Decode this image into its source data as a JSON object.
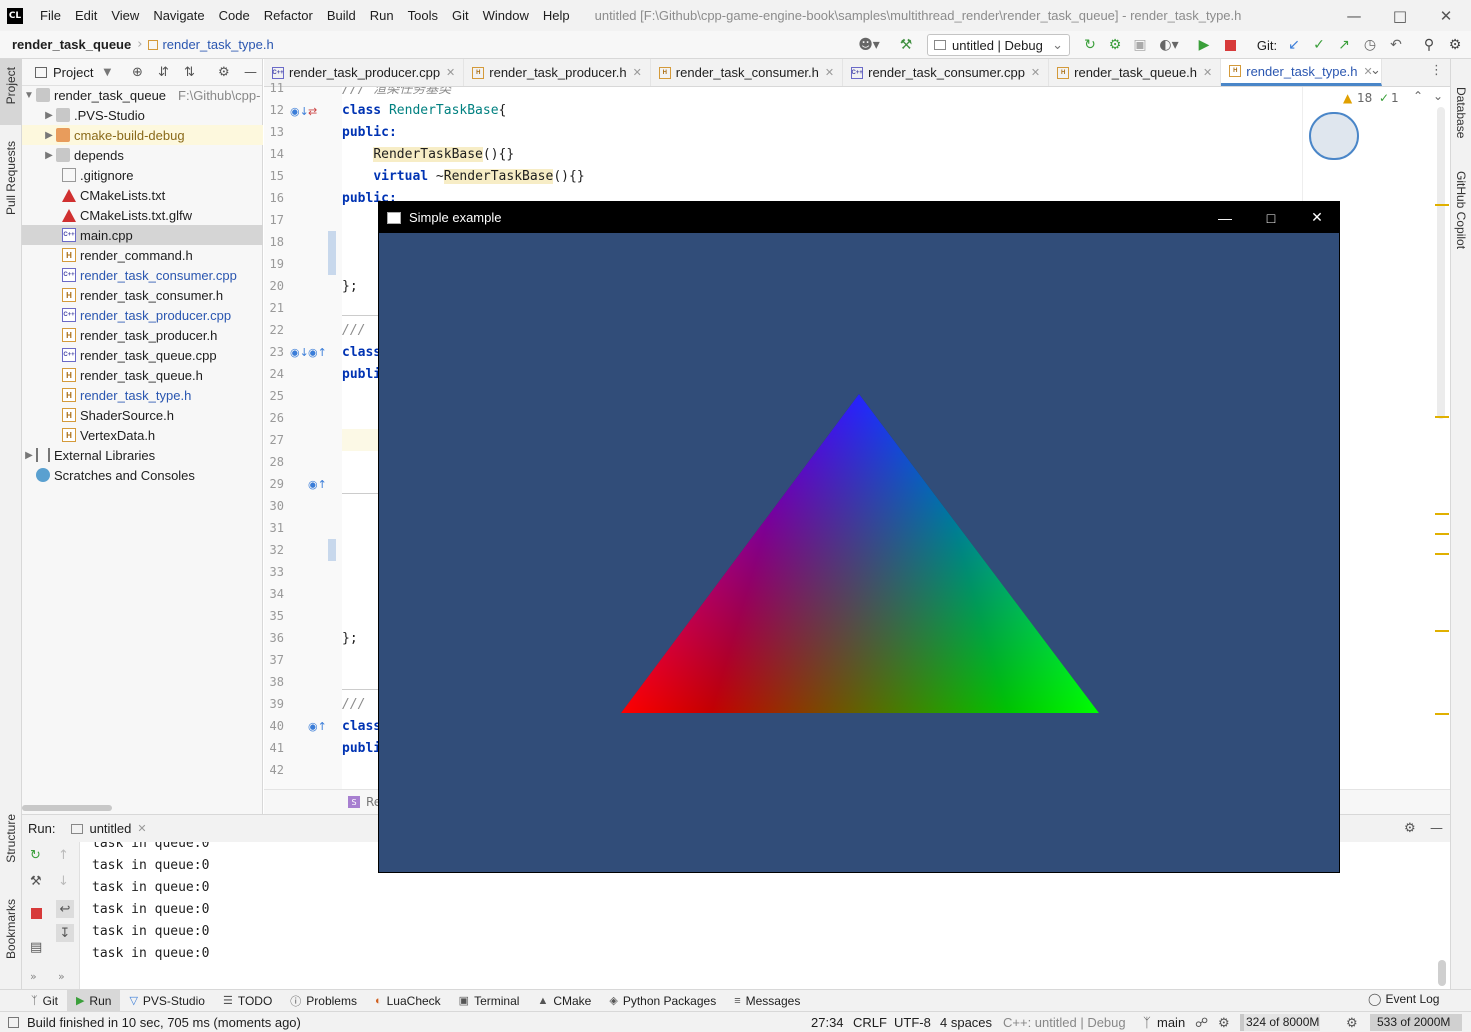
{
  "app": {
    "logo": "CL",
    "menu": [
      "File",
      "Edit",
      "View",
      "Navigate",
      "Code",
      "Refactor",
      "Build",
      "Run",
      "Tools",
      "Git",
      "Window",
      "Help"
    ],
    "title": "untitled [F:\\Github\\cpp-game-engine-book\\samples\\multithread_render\\render_task_queue] - render_task_type.h"
  },
  "navbar": {
    "project": "render_task_queue",
    "file": "render_task_type.h",
    "run_config": "untitled | Debug",
    "git_label": "Git:"
  },
  "left_strip": {
    "project": "Project",
    "pull_requests": "Pull Requests",
    "structure": "Structure",
    "bookmarks": "Bookmarks"
  },
  "right_strip": {
    "database": "Database",
    "copilot": "GitHub Copilot"
  },
  "project_panel": {
    "title": "Project",
    "root": {
      "name": "render_task_queue",
      "path": "F:\\Github\\cpp-"
    },
    "items": [
      {
        "label": ".PVS-Studio",
        "kind": "folder"
      },
      {
        "label": "cmake-build-debug",
        "kind": "folder-orange"
      },
      {
        "label": "depends",
        "kind": "folder"
      },
      {
        "label": ".gitignore",
        "kind": "file"
      },
      {
        "label": "CMakeLists.txt",
        "kind": "cmake"
      },
      {
        "label": "CMakeLists.txt.glfw",
        "kind": "cmake"
      },
      {
        "label": "main.cpp",
        "kind": "cpp"
      },
      {
        "label": "render_command.h",
        "kind": "h"
      },
      {
        "label": "render_task_consumer.cpp",
        "kind": "cpp"
      },
      {
        "label": "render_task_consumer.h",
        "kind": "h"
      },
      {
        "label": "render_task_producer.cpp",
        "kind": "cpp"
      },
      {
        "label": "render_task_producer.h",
        "kind": "h"
      },
      {
        "label": "render_task_queue.cpp",
        "kind": "cpp"
      },
      {
        "label": "render_task_queue.h",
        "kind": "h"
      },
      {
        "label": "render_task_type.h",
        "kind": "h"
      },
      {
        "label": "ShaderSource.h",
        "kind": "h"
      },
      {
        "label": "VertexData.h",
        "kind": "h"
      }
    ],
    "external": "External Libraries",
    "scratches": "Scratches and Consoles"
  },
  "tabs": [
    {
      "label": "render_task_producer.cpp",
      "kind": "cpp"
    },
    {
      "label": "render_task_producer.h",
      "kind": "h"
    },
    {
      "label": "render_task_consumer.h",
      "kind": "h"
    },
    {
      "label": "render_task_consumer.cpp",
      "kind": "cpp"
    },
    {
      "label": "render_task_queue.h",
      "kind": "h"
    },
    {
      "label": "render_task_type.h",
      "kind": "h",
      "active": true
    }
  ],
  "editor": {
    "line_numbers": [
      "11",
      "12",
      "13",
      "14",
      "15",
      "16",
      "17",
      "18",
      "19",
      "20",
      "21",
      "22",
      "23",
      "24",
      "25",
      "26",
      "27",
      "28",
      "29",
      "30",
      "31",
      "32",
      "33",
      "34",
      "35",
      "36",
      "37",
      "38",
      "39",
      "40",
      "41",
      "42"
    ],
    "comment_top": "/// 渲染任务基类",
    "code": {
      "l12_kw": "class",
      "l12_cls": "RenderTaskBase",
      "l12_rest": "{",
      "l13": "public:",
      "l14_name": "RenderTaskBase",
      "l14_rest": "(){}",
      "l15_kw": "virtual",
      "l15_tilde": " ~",
      "l15_name": "RenderTaskBase",
      "l15_rest": "(){}",
      "l16": "public:",
      "l20": "};",
      "l22": "/// ",
      "l23": "class",
      "l24": "publi",
      "l36": "};",
      "l39": "/// ",
      "l40": "class",
      "l41": "publi"
    },
    "inspections": {
      "warnings": "18",
      "ok": "1"
    },
    "footer_text": "Re"
  },
  "run_panel": {
    "label": "Run:",
    "tab": "untitled",
    "output": [
      "task in queue:0",
      "task in queue:0",
      "task in queue:0",
      "task in queue:0",
      "task in queue:0",
      "task in queue:0"
    ]
  },
  "tool_tabs": [
    {
      "label": "Git",
      "icon": "branch-icon"
    },
    {
      "label": "Run",
      "icon": "run-icon",
      "active": true
    },
    {
      "label": "PVS-Studio",
      "icon": "pvs-icon"
    },
    {
      "label": "TODO",
      "icon": "list-icon"
    },
    {
      "label": "Problems",
      "icon": "problems-icon"
    },
    {
      "label": "LuaCheck",
      "icon": "luacheck-icon"
    },
    {
      "label": "Terminal",
      "icon": "terminal-icon"
    },
    {
      "label": "CMake",
      "icon": "cmake-icon"
    },
    {
      "label": "Python Packages",
      "icon": "packages-icon"
    },
    {
      "label": "Messages",
      "icon": "messages-icon"
    }
  ],
  "event_log": "Event Log",
  "status": {
    "message": "Build finished in 10 sec, 705 ms (moments ago)",
    "position": "27:34",
    "line_sep": "CRLF",
    "encoding": "UTF-8",
    "indent": "4 spaces",
    "context": "C++: untitled | Debug",
    "branch": "main",
    "memory1": "324 of 8000M",
    "memory2": "533 of 2000M"
  },
  "glfw_window": {
    "title": "Simple example",
    "background": "#314d79",
    "triangle_colors": {
      "top": "#0000ff",
      "left": "#ff0000",
      "right": "#00ff00"
    }
  }
}
